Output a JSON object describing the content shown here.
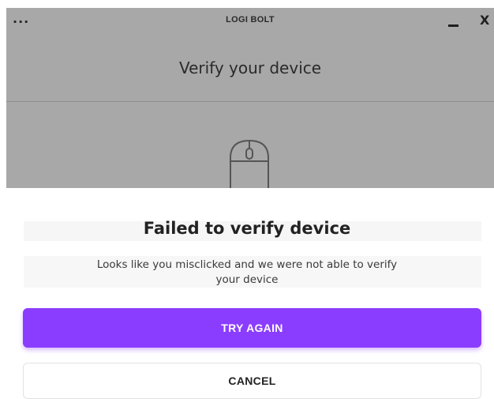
{
  "app": {
    "menu_icon": "more-dots-icon",
    "menu_glyph": "...",
    "title": "LOGI BOLT",
    "close_glyph": "X",
    "heading": "Verify your device",
    "illustration_icon": "mouse-icon"
  },
  "modal": {
    "title": "Failed to verify device",
    "message": "Looks like you misclicked and we were not able to verify your device",
    "primary_label": "TRY AGAIN",
    "secondary_label": "CANCEL"
  },
  "colors": {
    "accent": "#8b3dff",
    "overlay": "#a8a8a8",
    "modal_background": "#ffffff"
  }
}
